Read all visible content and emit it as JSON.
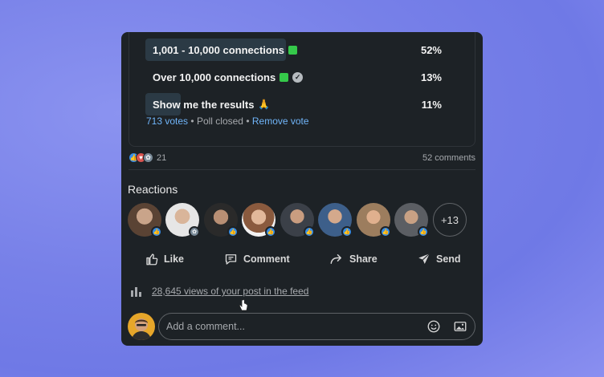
{
  "poll": {
    "options": [
      {
        "label": "1,001 - 10,000 connections",
        "percent": "52%",
        "fill": 0.52,
        "badge": "green",
        "checked": false
      },
      {
        "label": "Over 10,000 connections",
        "percent": "13%",
        "fill": 0.13,
        "badge": "green",
        "checked": true
      },
      {
        "label": "Show me the results",
        "percent": "11%",
        "fill": 0.11,
        "badge": "pray",
        "checked": false
      }
    ],
    "votes": "713 votes",
    "separator": "•",
    "status": "Poll closed",
    "remove_vote": "Remove vote"
  },
  "social": {
    "reaction_count": "21",
    "comments": "52 comments"
  },
  "reactions": {
    "title": "Reactions",
    "more": "+13"
  },
  "actions": {
    "like": "Like",
    "comment": "Comment",
    "share": "Share",
    "send": "Send"
  },
  "views": {
    "text": "28,645 views of your post in the feed"
  },
  "comment_box": {
    "placeholder": "Add a comment..."
  },
  "colors": {
    "card_bg": "#1d2226",
    "accent_blue": "#70b5f9",
    "like_blue": "#378fe9",
    "poll_fill": "#2b3a45"
  }
}
